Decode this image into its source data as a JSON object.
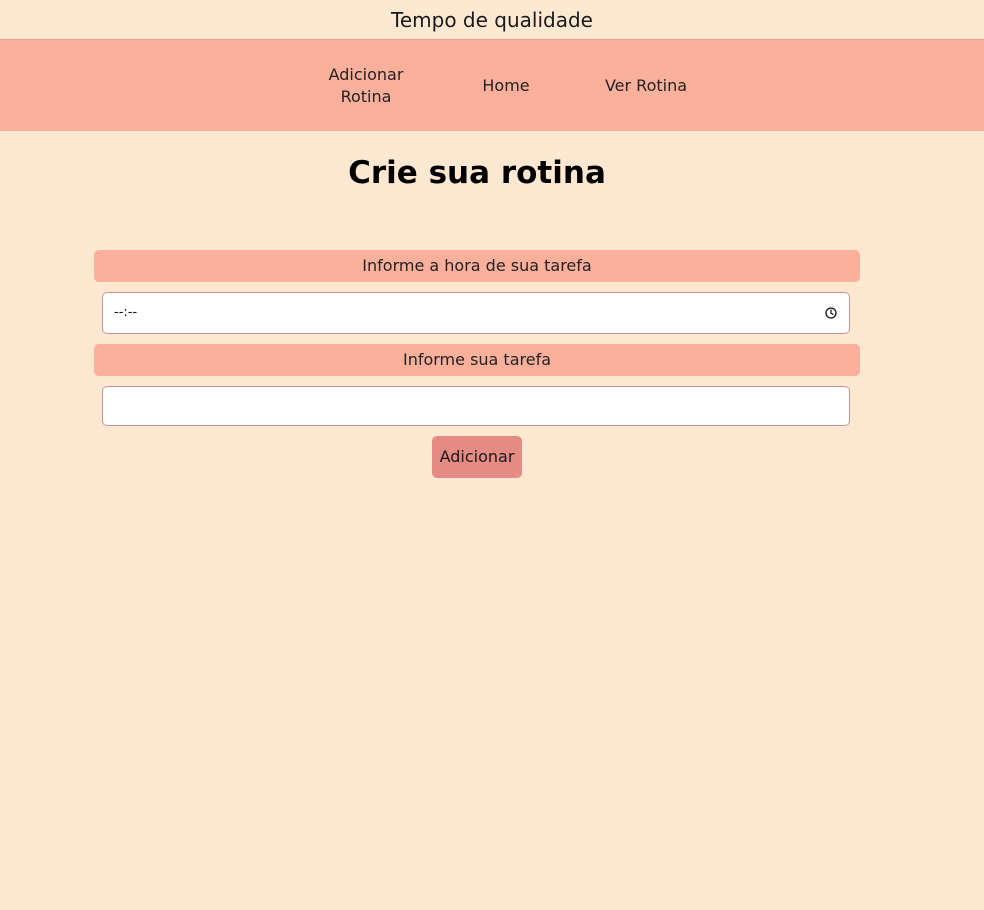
{
  "site": {
    "title": "Tempo de qualidade"
  },
  "nav": {
    "add_line1": "Adicionar",
    "add_line2": "Rotina",
    "home": "Home",
    "view": "Ver Rotina"
  },
  "main": {
    "heading": "Crie sua rotina",
    "time_label": "Informe a hora de sua tarefa",
    "time_placeholder": "--:--",
    "time_icon": "clock-icon",
    "task_label": "Informe sua tarefa",
    "task_value": "",
    "submit_label": "Adicionar"
  },
  "colors": {
    "background": "#fee8d2",
    "nav_background": "#fbb09c",
    "label_background": "#fbb09c",
    "button_background": "#e48c84"
  }
}
